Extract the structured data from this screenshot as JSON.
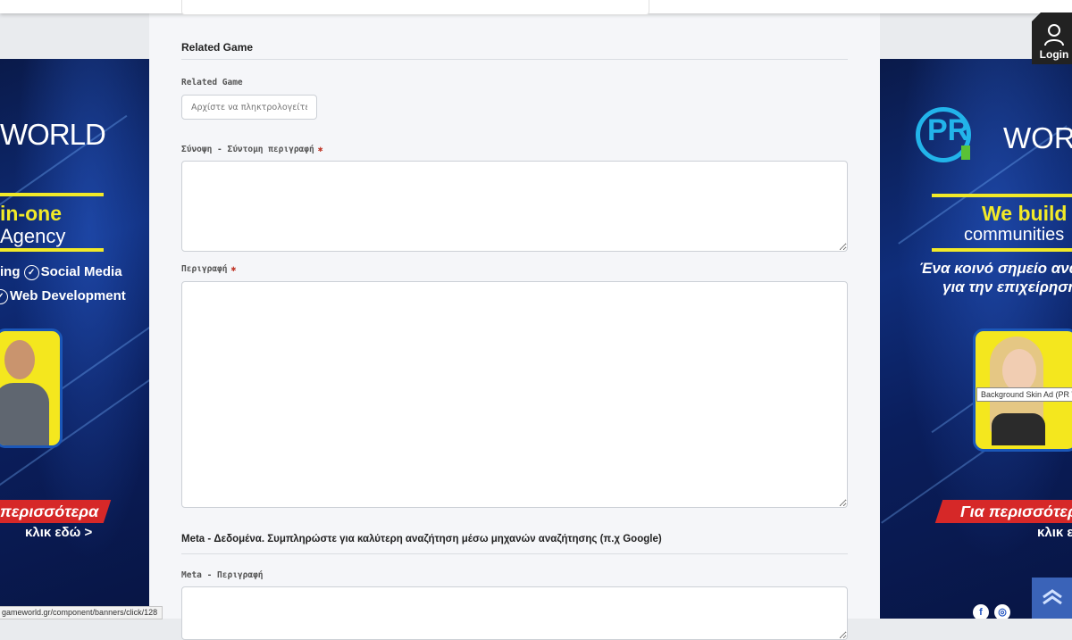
{
  "left_ad": {
    "logo": "WORLD",
    "headline_line1": "in-one",
    "headline_line2": "Agency",
    "service1_prefix": "ing",
    "service1": "Social Media",
    "service2": "Web Development",
    "cta": "περισσότερα",
    "cta_link": "κλικ εδώ >"
  },
  "right_ad": {
    "logo_letters": "PR",
    "logo": "WORL",
    "headline_line1": "We build",
    "headline_line2": "communities",
    "greek_line1": "Ένα κοινό σημείο ανα",
    "greek_line2": "για την επιχείρησή",
    "cta": "Για περισσότερ",
    "cta_link": "κλικ ε",
    "tooltip": "Background Skin Ad (PR World"
  },
  "status_url": "gameworld.gr/component/banners/click/128",
  "login": {
    "label": "Login"
  },
  "form": {
    "related_section_title": "Related Game",
    "related_label": "Related Game",
    "related_placeholder": "Αρχίστε να πληκτρολογείτε για",
    "summary_label": "Σύνοψη - Σύντομη περιγραφή",
    "description_label": "Περιγραφή",
    "required_marker": "✱",
    "meta_section_title": "Meta - Δεδομένα. Συμπληρώστε για καλύτερη αναζήτηση μέσω μηχανών αναζήτησης (π.χ Google)",
    "meta_description_label": "Meta - Περιγραφή"
  }
}
